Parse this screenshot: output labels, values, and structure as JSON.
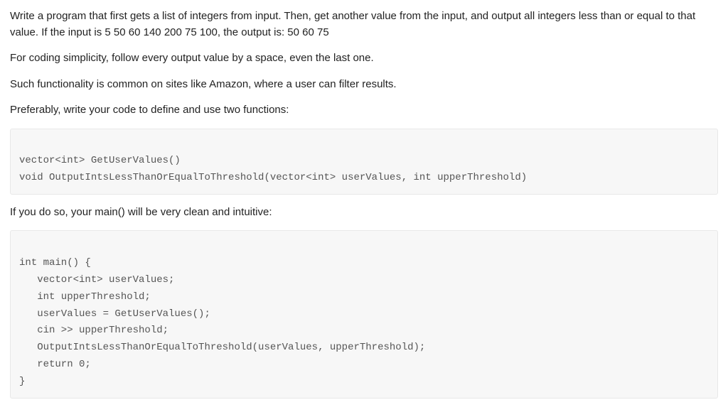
{
  "intro": {
    "p1": "Write a program that first gets a list of integers from input. Then, get another value from the input, and output all integers less than or equal to that value. If the input is 5 50 60 140 200 75 100, the output is: 50 60 75",
    "p2": "For coding simplicity, follow every output value by a space, even the last one.",
    "p3": "Such functionality is common on sites like Amazon, where a user can filter results.",
    "p4": "Preferably, write your code to define and use two functions:"
  },
  "code1": {
    "l1": "vector<int> GetUserValues()",
    "l2": "void OutputIntsLessThanOrEqualToThreshold(vector<int> userValues, int upperThreshold)"
  },
  "middle": {
    "text": "If you do so, your main() will be very clean and intuitive:"
  },
  "code2": {
    "l1": "int main() {",
    "l2": "   vector<int> userValues;",
    "l3": "   int upperThreshold;",
    "l4": "",
    "l5": "   userValues = GetUserValues();",
    "l6": "",
    "l7": "   cin >> upperThreshold;",
    "l8": "",
    "l9": "   OutputIntsLessThanOrEqualToThreshold(userValues, upperThreshold);",
    "l10": "",
    "l11": "   return 0;",
    "l12": "}"
  }
}
